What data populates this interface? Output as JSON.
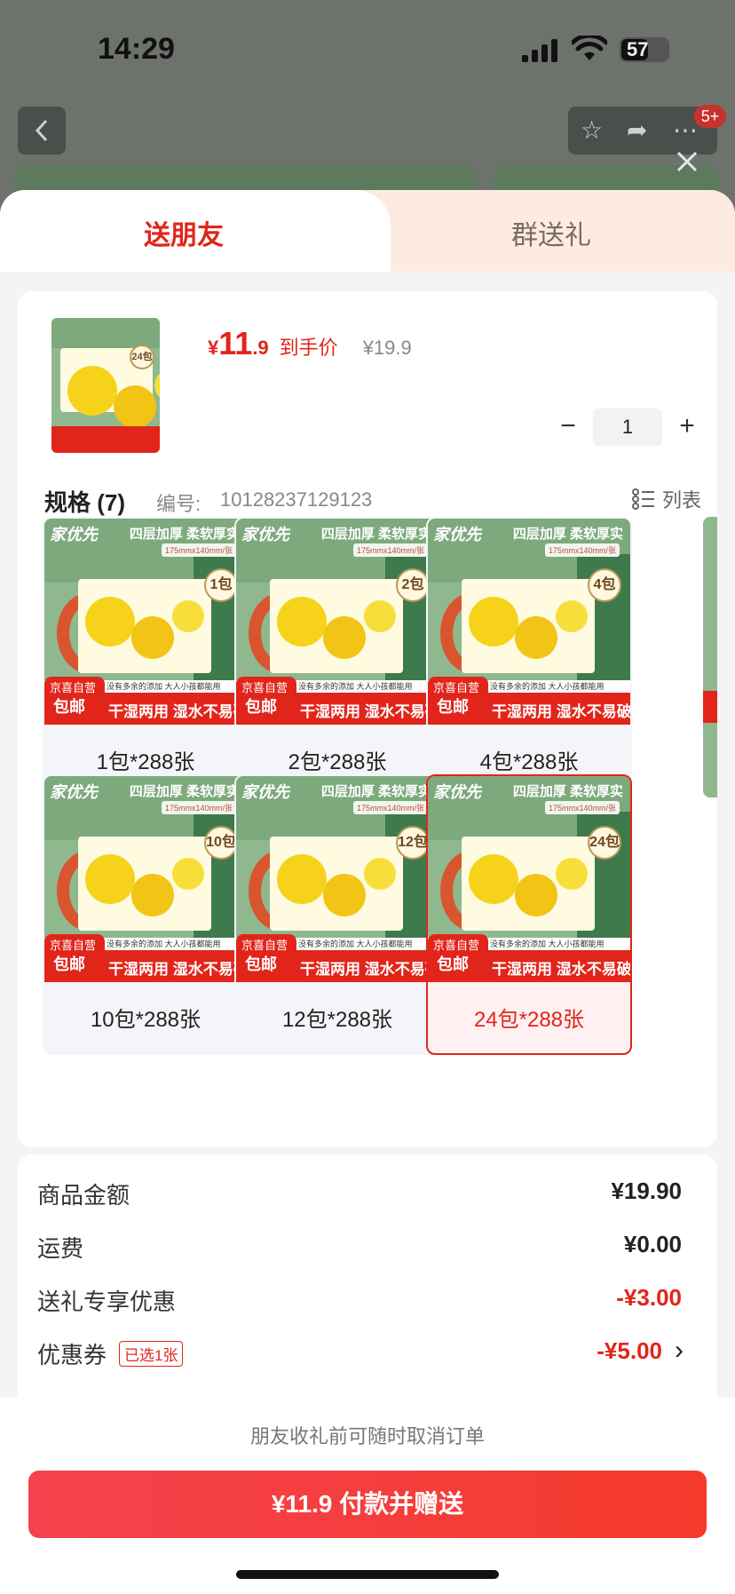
{
  "status_bar": {
    "time": "14:29",
    "battery": "57",
    "battery_level": 0.57
  },
  "background": {
    "message_badge": "5+"
  },
  "tabs": {
    "send_friend": "送朋友",
    "group_gift": "群送礼"
  },
  "product": {
    "price_currency": "¥",
    "price_integer": "11",
    "price_decimal": ".9",
    "price_tag": "到手价",
    "original_price": "¥19.9",
    "quantity": "1",
    "thumb_count": "24包"
  },
  "spec": {
    "title": "规格 (7)",
    "code_label": "编号:",
    "code": "10128237129123",
    "view_toggle": "列表"
  },
  "image_text": {
    "logo": "家优先",
    "slogan": "四层加厚 柔软厚实",
    "size": "175mmx140mm/张",
    "tagline": "没有多余的添加  大人小孩都能用",
    "jd_self": "京喜自营",
    "free_ship": "包邮",
    "feature": "干湿两用 湿水不易破"
  },
  "options": [
    {
      "label": "1包*288张",
      "count": "1包",
      "selected": false
    },
    {
      "label": "2包*288张",
      "count": "2包",
      "selected": false
    },
    {
      "label": "4包*288张",
      "count": "4包",
      "selected": false
    },
    {
      "label": "10包*288张",
      "count": "10包",
      "selected": false
    },
    {
      "label": "12包*288张",
      "count": "12包",
      "selected": false
    },
    {
      "label": "24包*288张",
      "count": "24包",
      "selected": true
    }
  ],
  "fees": {
    "goods_label": "商品金额",
    "goods_value": "¥19.90",
    "shipping_label": "运费",
    "shipping_value": "¥0.00",
    "gift_label": "送礼专享优惠",
    "gift_value": "-¥3.00",
    "coupon_label": "优惠券",
    "coupon_badge": "已选1张",
    "coupon_value": "-¥5.00"
  },
  "footer": {
    "cancel_note": "朋友收礼前可随时取消订单",
    "pay_button": "¥11.9 付款并赠送"
  },
  "colors": {
    "accent": "#e1251b",
    "tab_bg": "#fdebe2",
    "pay_gradient_start": "#f5424e",
    "pay_gradient_end": "#f53a2c"
  }
}
